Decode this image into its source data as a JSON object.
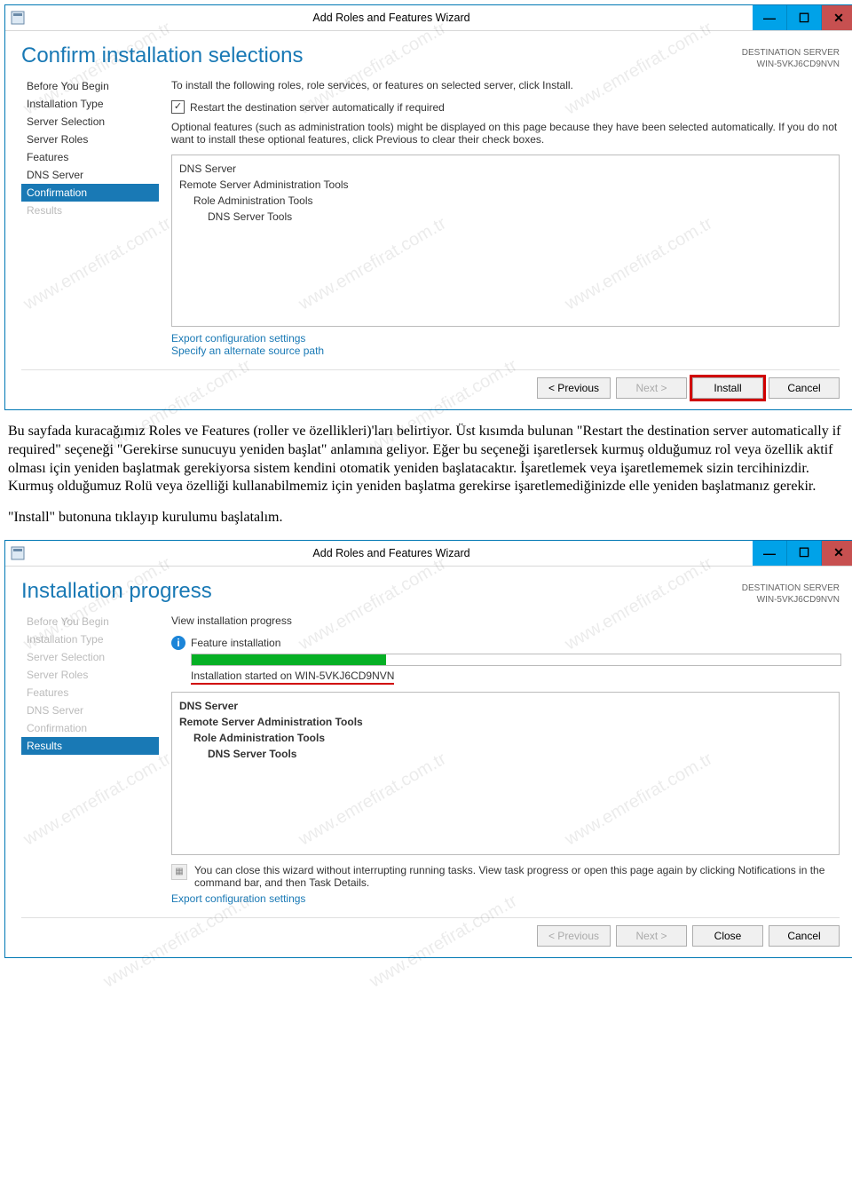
{
  "watermark": "www.emrefirat.com.tr",
  "article": {
    "p1": "Bu sayfada kuracağımız Roles ve Features (roller ve özellikleri)'ları belirtiyor. Üst kısımda bulunan \"Restart the destination server automatically if required\" seçeneği \"Gerekirse sunucuyu yeniden başlat\" anlamına geliyor. Eğer bu seçeneği işaretlersek kurmuş olduğumuz rol veya özellik aktif olması için yeniden başlatmak gerekiyorsa sistem kendini otomatik yeniden başlatacaktır. İşaretlemek veya işaretlememek sizin tercihinizdir. Kurmuş olduğumuz Rolü veya özelliği kullanabilmemiz için yeniden başlatma gerekirse işaretlemediğinizde elle yeniden başlatmanız gerekir.",
    "p2": "\"Install\" butonuna tıklayıp kurulumu başlatalım."
  },
  "win1": {
    "title": "Add Roles and Features Wizard",
    "bigtitle": "Confirm installation selections",
    "destLabel": "DESTINATION SERVER",
    "destServer": "WIN-5VKJ6CD9NVN",
    "nav": [
      "Before You Begin",
      "Installation Type",
      "Server Selection",
      "Server Roles",
      "Features",
      "DNS Server",
      "Confirmation",
      "Results"
    ],
    "intro": "To install the following roles, role services, or features on selected server, click Install.",
    "cbLabel": "Restart the destination server automatically if required",
    "optText": "Optional features (such as administration tools) might be displayed on this page because they have been selected automatically. If you do not want to install these optional features, click Previous to clear their check boxes.",
    "items": [
      "DNS Server",
      "Remote Server Administration Tools",
      "Role Administration Tools",
      "DNS Server Tools"
    ],
    "link1": "Export configuration settings",
    "link2": "Specify an alternate source path",
    "btns": {
      "prev": "< Previous",
      "next": "Next >",
      "install": "Install",
      "cancel": "Cancel"
    }
  },
  "win2": {
    "title": "Add Roles and Features Wizard",
    "bigtitle": "Installation progress",
    "destLabel": "DESTINATION SERVER",
    "destServer": "WIN-5VKJ6CD9NVN",
    "nav": [
      "Before You Begin",
      "Installation Type",
      "Server Selection",
      "Server Roles",
      "Features",
      "DNS Server",
      "Confirmation",
      "Results"
    ],
    "viewLabel": "View installation progress",
    "featureInst": "Feature installation",
    "startedOn": "Installation started on WIN-5VKJ6CD9NVN",
    "items": [
      "DNS Server",
      "Remote Server Administration Tools",
      "Role Administration Tools",
      "DNS Server Tools"
    ],
    "closeNote": "You can close this wizard without interrupting running tasks. View task progress or open this page again by clicking Notifications in the command bar, and then Task Details.",
    "link1": "Export configuration settings",
    "btns": {
      "prev": "< Previous",
      "next": "Next >",
      "close": "Close",
      "cancel": "Cancel"
    }
  }
}
